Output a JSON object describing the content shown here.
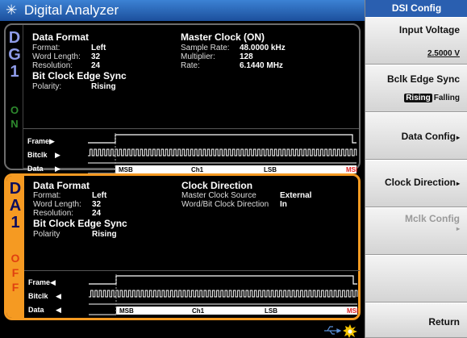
{
  "titlebar": {
    "title": "Digital Analyzer",
    "icon": "sun-icon"
  },
  "dg": {
    "sidebar_letters": [
      "D",
      "G",
      "1"
    ],
    "state_letters": [
      "O",
      "N"
    ],
    "data_format": {
      "heading": "Data Format",
      "rows": [
        {
          "label": "Format:",
          "value": "Left"
        },
        {
          "label": "Word Length:",
          "value": "32"
        },
        {
          "label": "Resolution:",
          "value": "24"
        }
      ]
    },
    "bit_clock": {
      "heading": "Bit Clock Edge Sync",
      "label": "Polarity:",
      "value": "Rising"
    },
    "master_clock": {
      "heading": "Master Clock (ON)",
      "rows": [
        {
          "label": "Sample Rate:",
          "value": "48.0000 kHz"
        },
        {
          "label": "Multiplier:",
          "value": "128"
        },
        {
          "label": "Rate:",
          "value": "6.1440 MHz"
        }
      ]
    },
    "timing": {
      "frame": "Frame",
      "bitclk": "Bitclk",
      "data": "Data",
      "msb": "MSB",
      "ch": "Ch1",
      "lsb": "LSB",
      "msb_end": "MSI"
    }
  },
  "da": {
    "sidebar_letters": [
      "D",
      "A",
      "1"
    ],
    "state_letters": [
      "O",
      "F",
      "F"
    ],
    "data_format": {
      "heading": "Data Format",
      "rows": [
        {
          "label": "Format:",
          "value": "Left"
        },
        {
          "label": "Word Length:",
          "value": "32"
        },
        {
          "label": "Resolution:",
          "value": "24"
        }
      ]
    },
    "bit_clock": {
      "heading": "Bit Clock Edge Sync",
      "label": "Polarity",
      "value": "Rising"
    },
    "clock_direction": {
      "heading": "Clock Direction",
      "rows": [
        {
          "label": "Master Clock Source",
          "value": "External"
        },
        {
          "label": "Word/Bit Clock Direction",
          "value": "In"
        }
      ]
    },
    "timing": {
      "frame": "Frame",
      "bitclk": "Bitclk",
      "data": "Data",
      "msb": "MSB",
      "ch": "Ch1",
      "lsb": "LSB",
      "msb_end": "MSI"
    }
  },
  "menu": {
    "header": "DSI Config",
    "input_voltage": {
      "label": "Input Voltage",
      "value": "2.5000 V"
    },
    "bclk_edge_sync": {
      "label": "Bclk Edge Sync",
      "selected": "Rising",
      "other": "Falling"
    },
    "data_config": "Data Config",
    "clock_direction": "Clock Direction",
    "mclk_config": "Mclk Config",
    "return": "Return",
    "arrow": "▸"
  },
  "status": {
    "usb_icon": "usb-icon",
    "warning_icon": "starburst-icon"
  }
}
